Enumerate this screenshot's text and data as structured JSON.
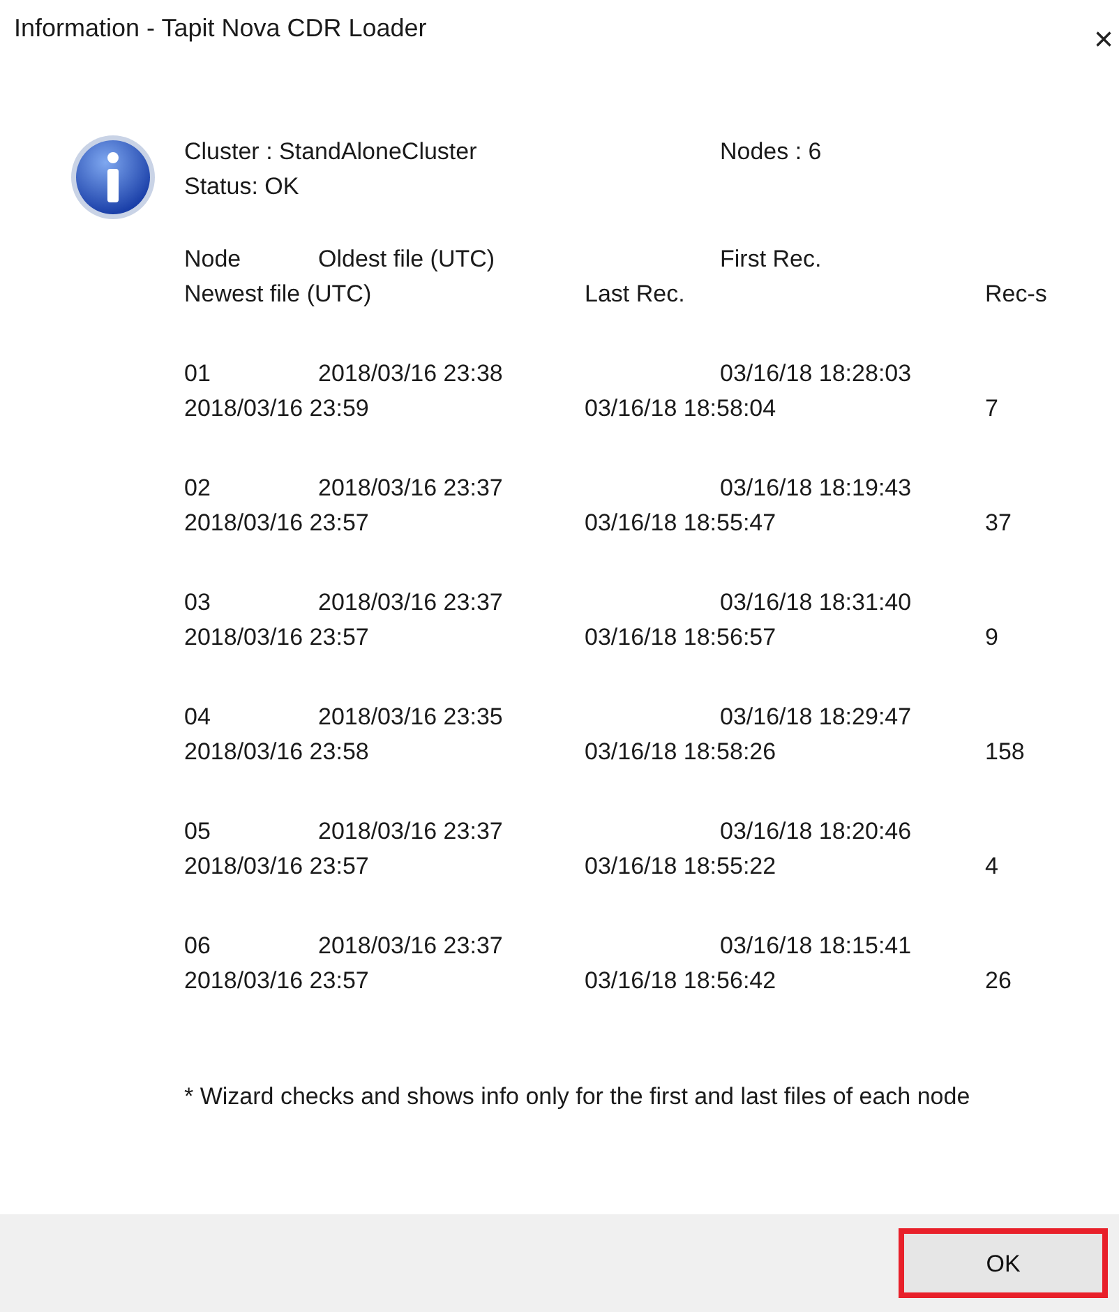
{
  "window": {
    "title": "Information - Tapit Nova CDR Loader",
    "close": "×"
  },
  "summary": {
    "cluster": "Cluster : StandAloneCluster",
    "nodes": "Nodes : 6",
    "status": "Status: OK"
  },
  "table": {
    "header_line_1": [
      "Node",
      "Oldest file (UTC)",
      "First Rec."
    ],
    "header_line_2": [
      "Newest file (UTC)",
      "Last Rec.",
      "Rec-s"
    ],
    "rows": [
      {
        "node": "01",
        "oldest": "2018/03/16 23:38",
        "first_rec": "03/16/18 18:28:03",
        "newest": "2018/03/16 23:59",
        "last_rec": "03/16/18 18:58:04",
        "recs": "7"
      },
      {
        "node": "02",
        "oldest": "2018/03/16 23:37",
        "first_rec": "03/16/18 18:19:43",
        "newest": "2018/03/16 23:57",
        "last_rec": "03/16/18 18:55:47",
        "recs": "37"
      },
      {
        "node": "03",
        "oldest": "2018/03/16 23:37",
        "first_rec": "03/16/18 18:31:40",
        "newest": "2018/03/16 23:57",
        "last_rec": "03/16/18 18:56:57",
        "recs": "9"
      },
      {
        "node": "04",
        "oldest": "2018/03/16 23:35",
        "first_rec": "03/16/18 18:29:47",
        "newest": "2018/03/16 23:58",
        "last_rec": "03/16/18 18:58:26",
        "recs": "158"
      },
      {
        "node": "05",
        "oldest": "2018/03/16 23:37",
        "first_rec": "03/16/18 18:20:46",
        "newest": "2018/03/16 23:57",
        "last_rec": "03/16/18 18:55:22",
        "recs": "4"
      },
      {
        "node": "06",
        "oldest": "2018/03/16 23:37",
        "first_rec": "03/16/18 18:15:41",
        "newest": "2018/03/16 23:57",
        "last_rec": "03/16/18 18:56:42",
        "recs": "26"
      }
    ]
  },
  "footnote": "* Wizard checks and shows info only for the first and last files of each node",
  "buttons": [
    {
      "label": "OK",
      "highlighted": true
    }
  ]
}
